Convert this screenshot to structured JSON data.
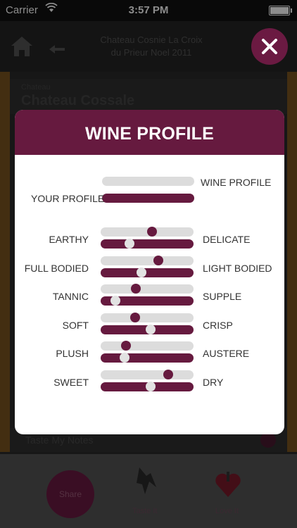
{
  "status_bar": {
    "carrier": "Carrier",
    "time": "3:57 PM"
  },
  "nav": {
    "title_line1": "Chateau Cosnie La Croix",
    "title_line2": "du Prieur Noel 2011"
  },
  "background": {
    "subtitle": "Chateau",
    "title": "Chateau Cossale",
    "tasting_text": "Taste My Notes"
  },
  "tabs": {
    "share_label": "Share",
    "taste_label": "Taste It",
    "love_label": "Love It"
  },
  "modal": {
    "title": "WINE PROFILE",
    "legend_wine": "WINE PROFILE",
    "legend_your": "YOUR PROFILE",
    "rows": [
      {
        "left": "EARTHY",
        "right": "DELICATE",
        "wine_value": 0.55,
        "your_value": 0.31
      },
      {
        "left": "FULL BODIED",
        "right": "LIGHT BODIED",
        "wine_value": 0.62,
        "your_value": 0.44
      },
      {
        "left": "TANNIC",
        "right": "SUPPLE",
        "wine_value": 0.38,
        "your_value": 0.16
      },
      {
        "left": "SOFT",
        "right": "CRISP",
        "wine_value": 0.37,
        "your_value": 0.54
      },
      {
        "left": "PLUSH",
        "right": "AUSTERE",
        "wine_value": 0.27,
        "your_value": 0.26
      },
      {
        "left": "SWEET",
        "right": "DRY",
        "wine_value": 0.73,
        "your_value": 0.54
      }
    ]
  },
  "colors": {
    "brand": "#661a3f",
    "track_grey": "#dcdcdc"
  }
}
